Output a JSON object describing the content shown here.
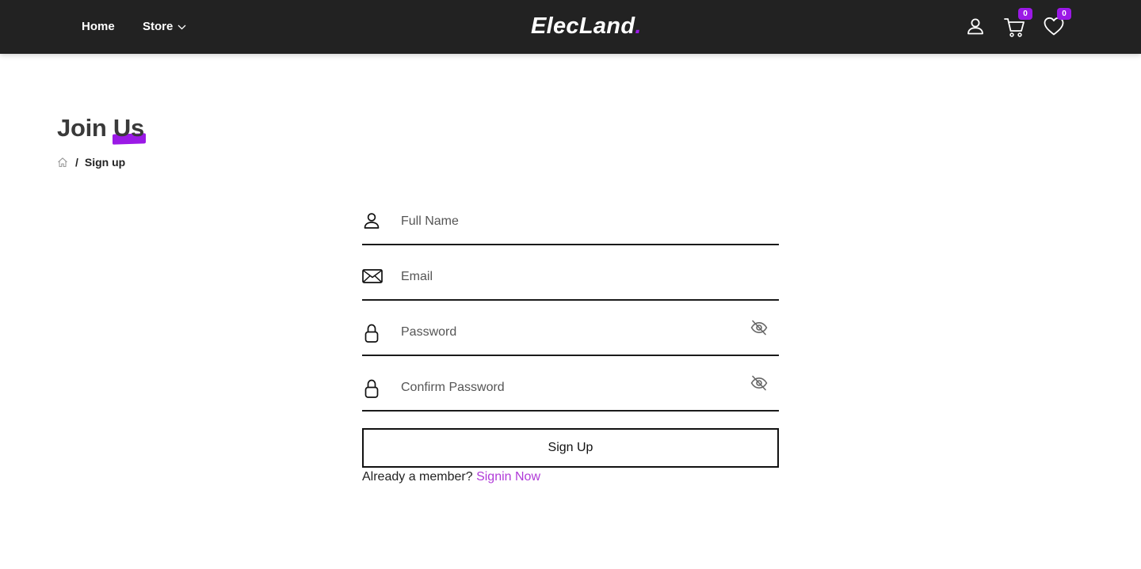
{
  "nav": {
    "home_label": "Home",
    "store_label": "Store",
    "brand_text": "ElecLand",
    "brand_dot": ".",
    "cart_count": "0",
    "wishlist_count": "0",
    "icons": {
      "store_dropdown": "chevron-down-icon",
      "account": "user-icon",
      "cart": "cart-icon",
      "wishlist": "heart-icon"
    }
  },
  "page": {
    "title_part1": "Join",
    "title_part2": "Us",
    "breadcrumb": {
      "home_icon": "home-icon",
      "separator": "/",
      "current": "Sign up"
    }
  },
  "form": {
    "full_name": {
      "placeholder": "Full Name",
      "value": "",
      "icon": "user-icon"
    },
    "email": {
      "placeholder": "Email",
      "value": "",
      "icon": "envelope-icon"
    },
    "password": {
      "placeholder": "Password",
      "value": "",
      "icon": "lock-icon",
      "toggle_icon": "eye-slash-icon"
    },
    "confirm_password": {
      "placeholder": "Confirm Password",
      "value": "",
      "icon": "lock-icon",
      "toggle_icon": "eye-slash-icon"
    },
    "submit_label": "Sign Up",
    "member_text": "Already a member?",
    "signin_link": "Signin Now"
  },
  "colors": {
    "nav_bg": "#222222",
    "accent": "#9b19e6",
    "link": "#b03ad8"
  }
}
